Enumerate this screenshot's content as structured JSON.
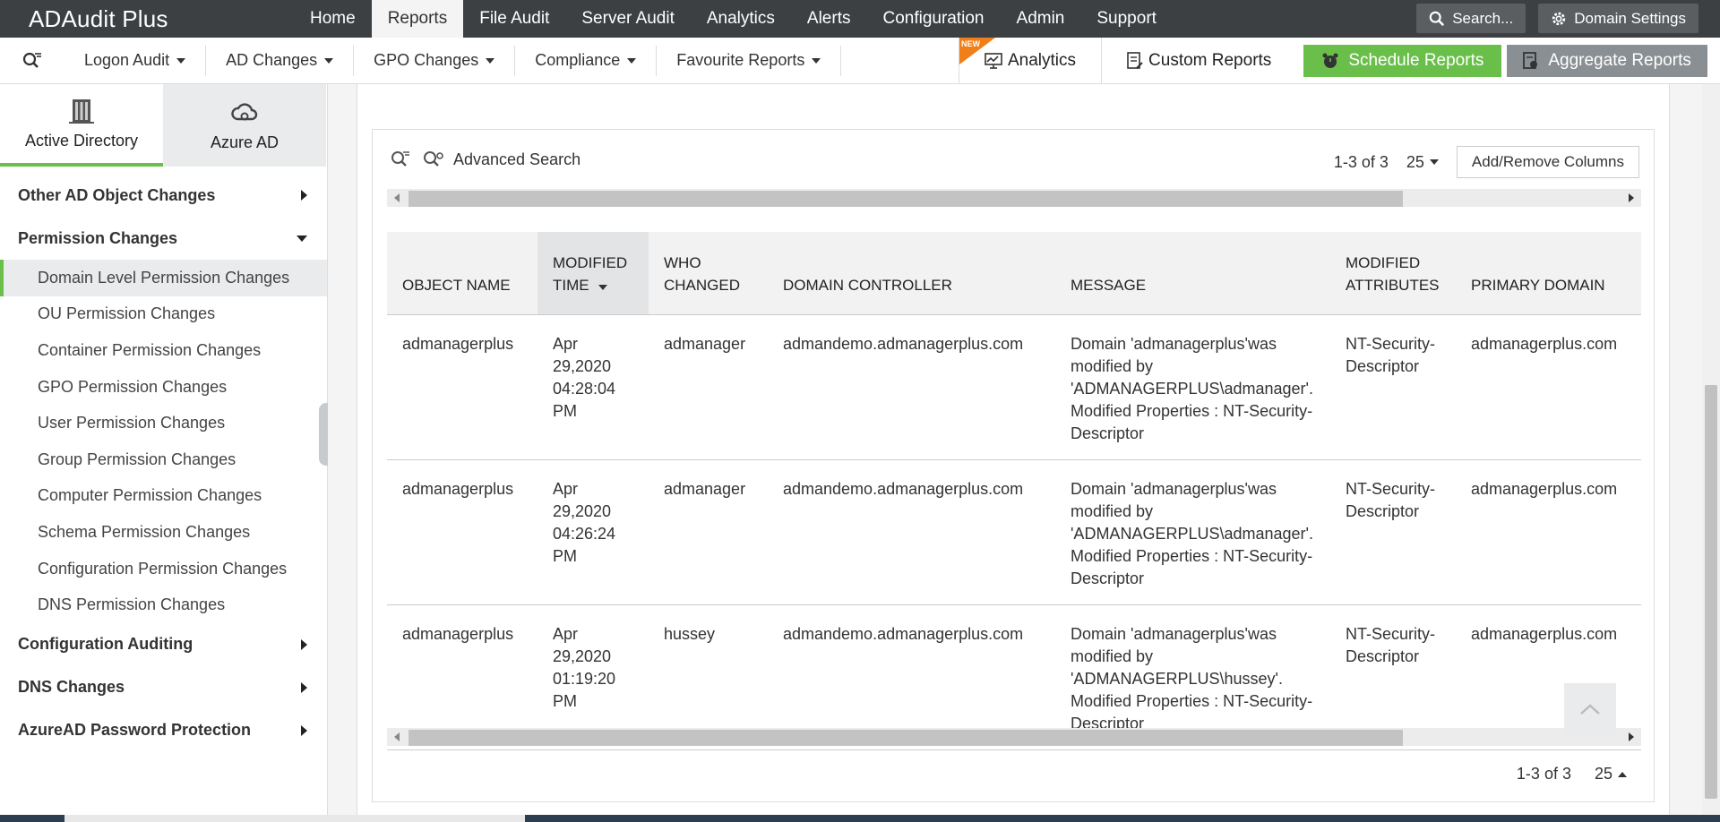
{
  "app": {
    "title": "ADAudit Plus"
  },
  "topnav": {
    "items": [
      "Home",
      "Reports",
      "File Audit",
      "Server Audit",
      "Analytics",
      "Alerts",
      "Configuration",
      "Admin",
      "Support"
    ],
    "active": "Reports",
    "search_label": "Search...",
    "domain_settings_label": "Domain Settings"
  },
  "subnav": {
    "menus": [
      "Logon Audit",
      "AD Changes",
      "GPO Changes",
      "Compliance",
      "Favourite Reports"
    ],
    "analytics_label": "Analytics",
    "new_badge": "NEW",
    "custom_reports_label": "Custom Reports",
    "schedule_reports_label": "Schedule Reports",
    "aggregate_reports_label": "Aggregate Reports"
  },
  "sidebar": {
    "tabs": [
      "Active Directory",
      "Azure AD"
    ],
    "active_tab": "Active Directory",
    "sections": {
      "other_ad": "Other AD Object Changes",
      "permission": "Permission Changes",
      "configuration": "Configuration Auditing",
      "dns": "DNS Changes",
      "azuread_pw": "AzureAD Password Protection"
    },
    "permission_items": [
      "Domain Level Permission Changes",
      "OU Permission Changes",
      "Container Permission Changes",
      "GPO Permission Changes",
      "User Permission Changes",
      "Group Permission Changes",
      "Computer Permission Changes",
      "Schema Permission Changes",
      "Configuration Permission Changes",
      "DNS Permission Changes"
    ],
    "active_item": "Domain Level Permission Changes"
  },
  "report": {
    "advanced_search_label": "Advanced Search",
    "range": "1-3 of 3",
    "page_size": "25",
    "add_remove_columns_label": "Add/Remove Columns",
    "columns": [
      "OBJECT NAME",
      "MODIFIED TIME",
      "WHO CHANGED",
      "DOMAIN CONTROLLER",
      "MESSAGE",
      "MODIFIED ATTRIBUTES",
      "PRIMARY DOMAIN"
    ],
    "sorted_column": "MODIFIED TIME",
    "rows": [
      {
        "object_name": "admanagerplus",
        "modified_time": "Apr 29,2020 04:28:04 PM",
        "who_changed": "admanager",
        "domain_controller": "admandemo.admanagerplus.com",
        "message": "Domain 'admanagerplus'was modified by 'ADMANAGERPLUS\\admanager'. Modified Properties : NT-Security-Descriptor",
        "modified_attributes": "NT-Security-Descriptor",
        "primary_domain": "admanagerplus.com"
      },
      {
        "object_name": "admanagerplus",
        "modified_time": "Apr 29,2020 04:26:24 PM",
        "who_changed": "admanager",
        "domain_controller": "admandemo.admanagerplus.com",
        "message": "Domain 'admanagerplus'was modified by 'ADMANAGERPLUS\\admanager'. Modified Properties : NT-Security-Descriptor",
        "modified_attributes": "NT-Security-Descriptor",
        "primary_domain": "admanagerplus.com"
      },
      {
        "object_name": "admanagerplus",
        "modified_time": "Apr 29,2020 01:19:20 PM",
        "who_changed": "hussey",
        "domain_controller": "admandemo.admanagerplus.com",
        "message": "Domain 'admanagerplus'was modified by 'ADMANAGERPLUS\\hussey'. Modified Properties : NT-Security-Descriptor",
        "modified_attributes": "NT-Security-Descriptor",
        "primary_domain": "admanagerplus.com"
      }
    ]
  },
  "colors": {
    "accent_green": "#6abf4b",
    "topbar_bg": "#3c4043",
    "new_badge": "#f07f1a"
  }
}
